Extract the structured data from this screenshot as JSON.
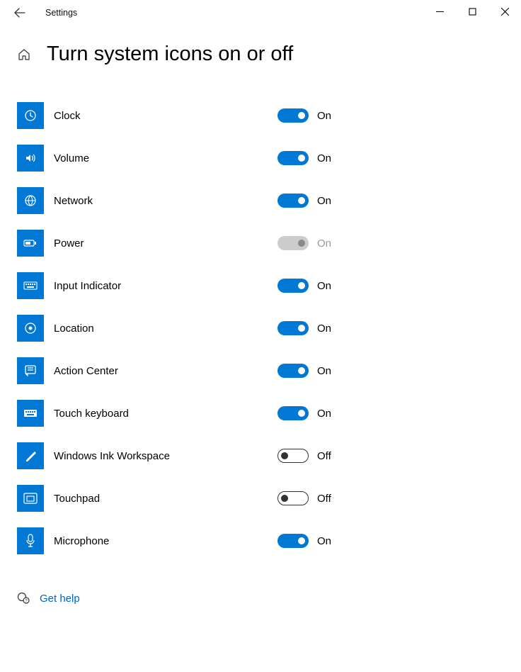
{
  "window": {
    "title": "Settings"
  },
  "page": {
    "heading": "Turn system icons on or off"
  },
  "labels": {
    "on": "On",
    "off": "Off"
  },
  "settings": [
    {
      "id": "clock",
      "label": "Clock",
      "state": "on",
      "icon": "clock-icon"
    },
    {
      "id": "volume",
      "label": "Volume",
      "state": "on",
      "icon": "volume-icon"
    },
    {
      "id": "network",
      "label": "Network",
      "state": "on",
      "icon": "network-icon"
    },
    {
      "id": "power",
      "label": "Power",
      "state": "disabled",
      "icon": "power-icon"
    },
    {
      "id": "input-indicator",
      "label": "Input Indicator",
      "state": "on",
      "icon": "keyboard-icon"
    },
    {
      "id": "location",
      "label": "Location",
      "state": "on",
      "icon": "location-icon"
    },
    {
      "id": "action-center",
      "label": "Action Center",
      "state": "on",
      "icon": "action-center-icon"
    },
    {
      "id": "touch-keyboard",
      "label": "Touch keyboard",
      "state": "on",
      "icon": "touch-keyboard-icon"
    },
    {
      "id": "windows-ink",
      "label": "Windows Ink Workspace",
      "state": "off",
      "icon": "ink-icon"
    },
    {
      "id": "touchpad",
      "label": "Touchpad",
      "state": "off",
      "icon": "touchpad-icon"
    },
    {
      "id": "microphone",
      "label": "Microphone",
      "state": "on",
      "icon": "microphone-icon"
    }
  ],
  "help": {
    "label": "Get help"
  }
}
